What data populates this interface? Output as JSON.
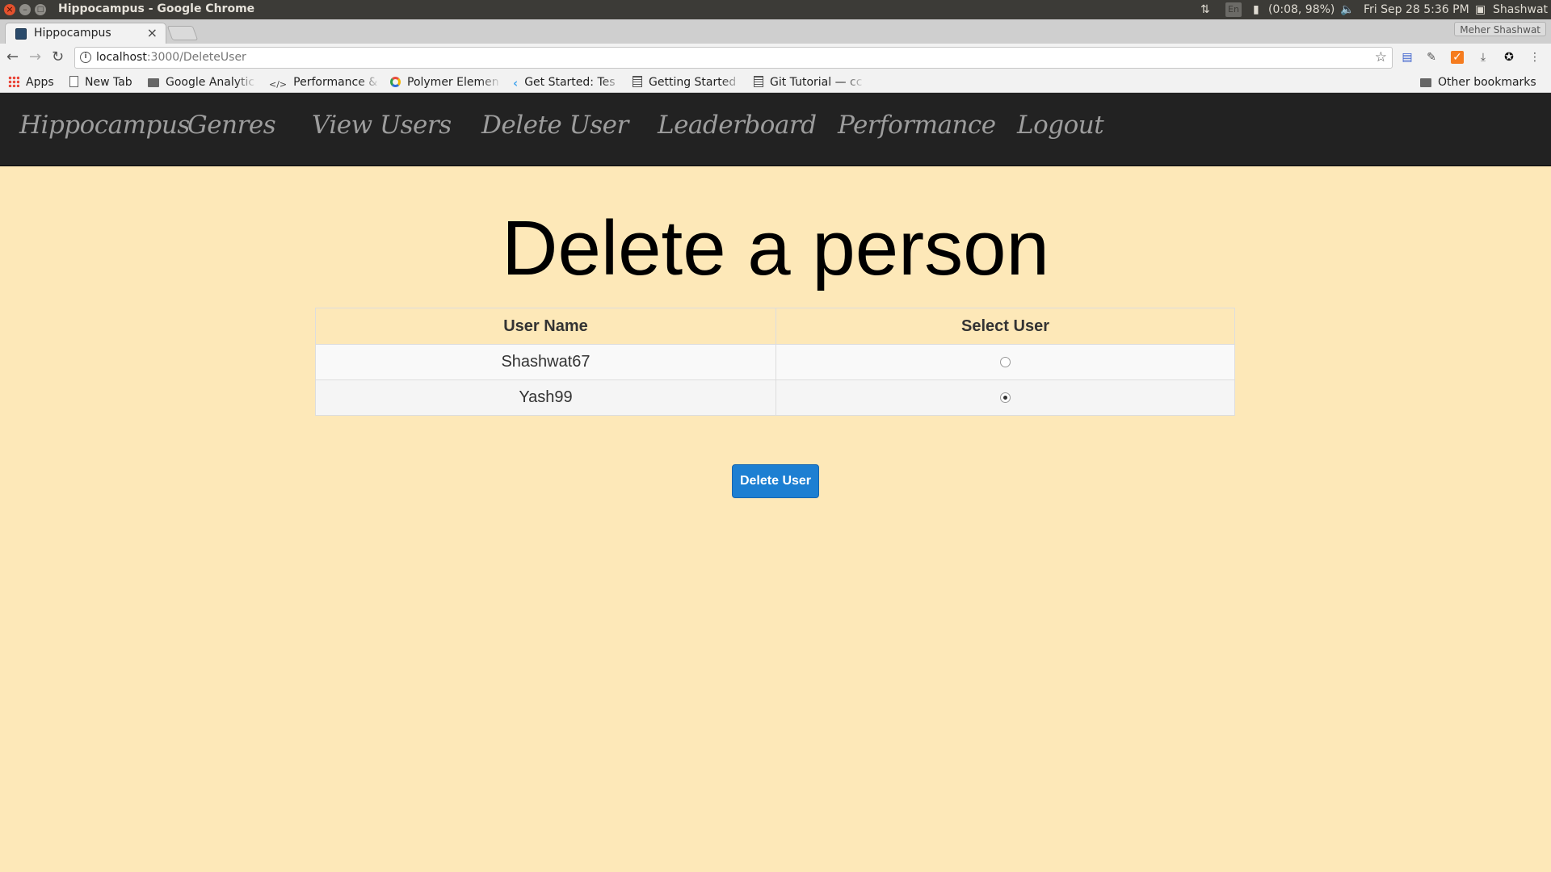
{
  "window": {
    "title": "Hippocampus - Google Chrome"
  },
  "system_tray": {
    "lang": "En",
    "battery": "(0:08, 98%)",
    "datetime": "Fri Sep 28  5:36 PM",
    "user": "Shashwat"
  },
  "tabs": [
    {
      "label": "Hippocampus",
      "active": true
    }
  ],
  "profile_name": "Meher Shashwat",
  "address_bar": {
    "host": "localhost",
    "path": ":3000/DeleteUser"
  },
  "bookmarks": [
    {
      "label": "Apps",
      "icon": "apps-icon"
    },
    {
      "label": "New Tab",
      "icon": "page-icon"
    },
    {
      "label": "Google Analytic",
      "icon": "folder-icon"
    },
    {
      "label": "Performance & ",
      "icon": "code-icon"
    },
    {
      "label": "Polymer Elemen",
      "icon": "polymer-icon"
    },
    {
      "label": "Get Started: Tes",
      "icon": "flutter-icon"
    },
    {
      "label": "Getting Started",
      "icon": "doc-icon"
    },
    {
      "label": "Git Tutorial — cc",
      "icon": "doc-icon"
    }
  ],
  "other_bookmarks": "Other bookmarks",
  "app_nav": {
    "brand": "Hippocampus",
    "links": [
      "Genres",
      "View Users",
      "Delete User",
      "Leaderboard",
      "Performance",
      "Logout"
    ]
  },
  "page": {
    "heading": "Delete a person",
    "table": {
      "headers": [
        "User Name",
        "Select User"
      ],
      "rows": [
        {
          "name": "Shashwat67",
          "selected": false
        },
        {
          "name": "Yash99",
          "selected": true
        }
      ]
    },
    "delete_button": "Delete User"
  },
  "colors": {
    "page_background": "#fde8b8",
    "navbar": "#222222",
    "button": "#1d7fd2"
  }
}
